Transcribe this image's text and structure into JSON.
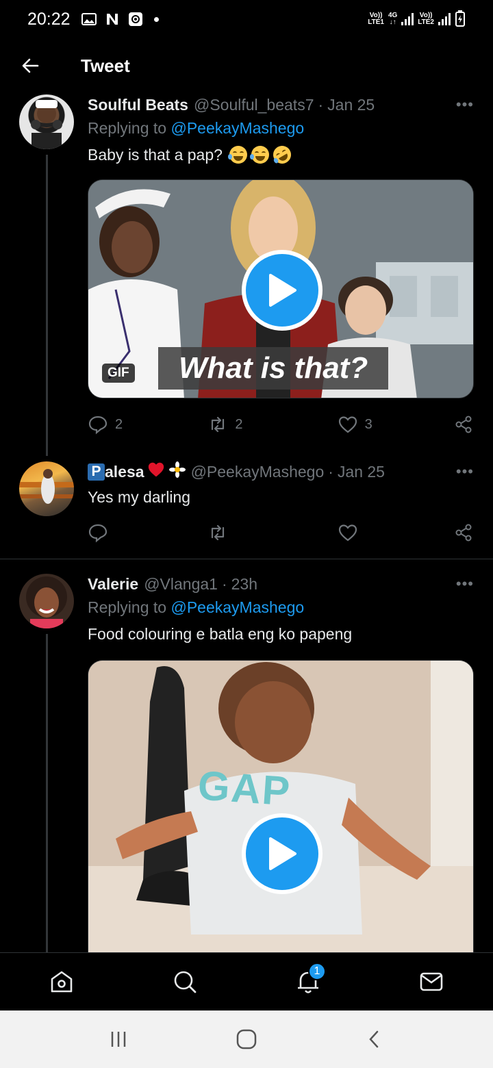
{
  "status_bar": {
    "time": "20:22",
    "icons": [
      "image-icon",
      "n-icon",
      "gear-badge-icon",
      "dot-icon"
    ],
    "sim1_label": "Vo)) LTE1",
    "network": "4G",
    "sim2_label": "Vo)) LTE2",
    "battery": "charging"
  },
  "header": {
    "title": "Tweet"
  },
  "tweets": [
    {
      "name": "Soulful Beats",
      "handle": "@Soulful_beats7",
      "time": "Jan 25",
      "replying_label": "Replying to",
      "replying_to": "@PeekayMashego",
      "text": "Baby is that a pap?",
      "emojis": [
        "joy-emoji",
        "joy-emoji",
        "rofl-emoji"
      ],
      "media": {
        "type": "gif",
        "badge": "GIF",
        "caption": "What is that?"
      },
      "replies": "2",
      "retweets": "2",
      "likes": "3"
    },
    {
      "name_initial": "P",
      "name": "alesa",
      "handle": "@PeekayMashego",
      "time": "Jan 25",
      "text": "Yes my darling",
      "replies": "",
      "retweets": "",
      "likes": ""
    },
    {
      "name": "Valerie",
      "handle": "@Vlanga1",
      "time": "23h",
      "replying_label": "Replying to",
      "replying_to": "@PeekayMashego",
      "text": "Food colouring e batla eng ko papeng",
      "media": {
        "type": "gif",
        "shirt_text": "GAP"
      }
    }
  ],
  "more_label": "•••",
  "bottom_nav": {
    "items": [
      "home-icon",
      "search-icon",
      "notifications-icon",
      "messages-icon"
    ],
    "notification_count": "1"
  },
  "colors": {
    "accent": "#1d9bf0",
    "background": "#000000",
    "secondary_text": "#71767b"
  }
}
